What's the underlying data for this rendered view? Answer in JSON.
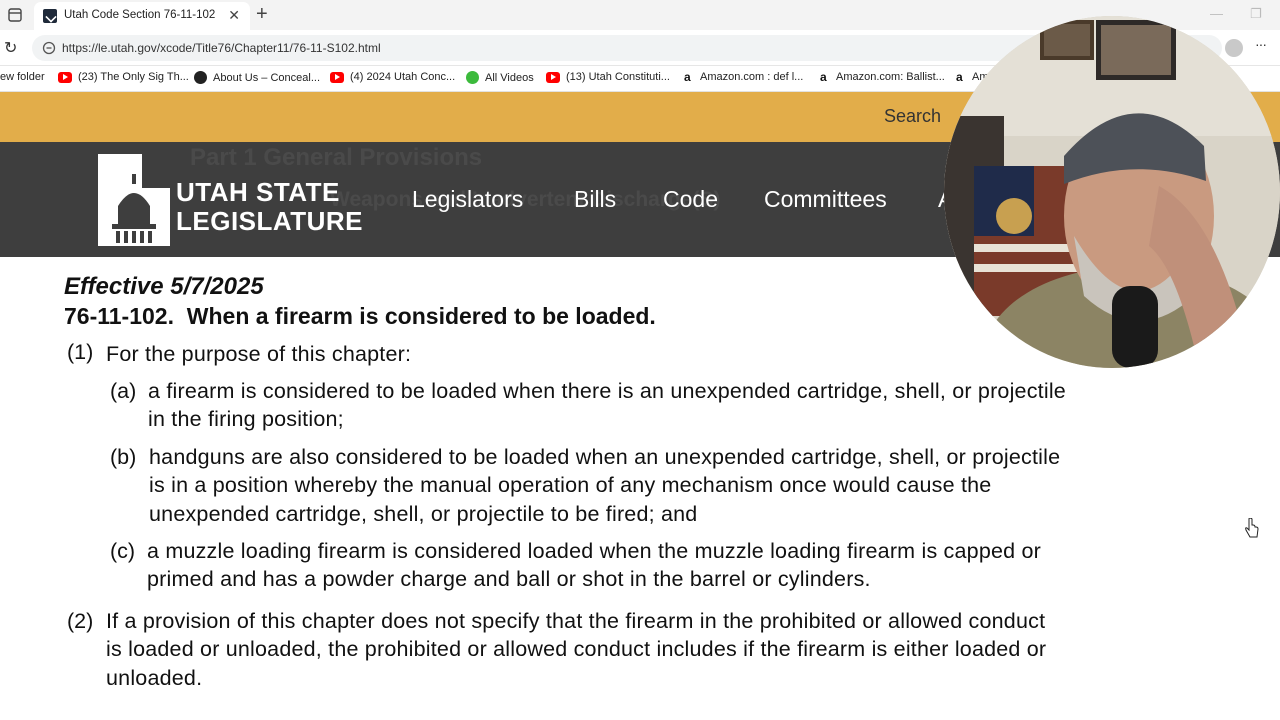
{
  "browser": {
    "tab_title": "Utah Code Section 76-11-102",
    "tab_close": "✕",
    "new_tab": "+",
    "url": "https://le.utah.gov/xcode/Title76/Chapter11/76-11-S102.html",
    "reload": "↻",
    "menu": "···",
    "bookmarks": [
      {
        "label": "ew folder",
        "icon": "folder-icon"
      },
      {
        "label": "(23) The Only Sig Th...",
        "icon": "youtube-icon"
      },
      {
        "label": "About Us – Conceal...",
        "icon": "site-icon"
      },
      {
        "label": "(4) 2024 Utah Conc...",
        "icon": "youtube-icon"
      },
      {
        "label": "All Videos",
        "icon": "play-icon"
      },
      {
        "label": "(13) Utah Constituti...",
        "icon": "youtube-icon"
      },
      {
        "label": "Amazon.com : def l...",
        "icon": "amazon-icon"
      },
      {
        "label": "Amazon.com: Ballist...",
        "icon": "amazon-icon"
      },
      {
        "label": "Am",
        "icon": "amazon-icon"
      }
    ]
  },
  "site": {
    "search_label": "Search",
    "logo_line1": "UTAH STATE",
    "logo_line2": "LEGISLATURE",
    "nav": [
      "Legislators",
      "Bills",
      "Code",
      "Committees",
      "A"
    ],
    "ghost_line1": "Part 1 General Provisions",
    "ghost_line2": "Weapons and Inadvertent Discharge(S)"
  },
  "document": {
    "effective": "Effective 5/7/2025",
    "section_number": "76-11-102.",
    "section_title": "When a firearm is considered to be loaded.",
    "p1_num": "(1)",
    "p1_text": "For the purpose of this chapter:",
    "a_num": "(a)",
    "a_line1": "a firearm is considered to be loaded when there is an unexpended cartridge, shell, or projectile",
    "a_line2": "in the firing position;",
    "b_num": "(b)",
    "b_line1": "handguns are also considered to be loaded when an unexpended cartridge, shell, or projectile",
    "b_line2": "is in a position whereby the manual operation of any mechanism once would cause the",
    "b_line3": "unexpended cartridge, shell, or projectile to be fired; and",
    "c_num": "(c)",
    "c_line1": "a muzzle loading firearm is considered loaded when the muzzle loading firearm is capped or",
    "c_line2": "primed and has a powder charge and ball or shot in the barrel or cylinders.",
    "p2_num": "(2)",
    "p2_line1": "If a provision of this chapter does not specify that the firearm in the prohibited or allowed conduct",
    "p2_line2": "is loaded or unloaded, the prohibited or allowed conduct includes if the firearm is either loaded or",
    "p2_line3": "unloaded."
  }
}
